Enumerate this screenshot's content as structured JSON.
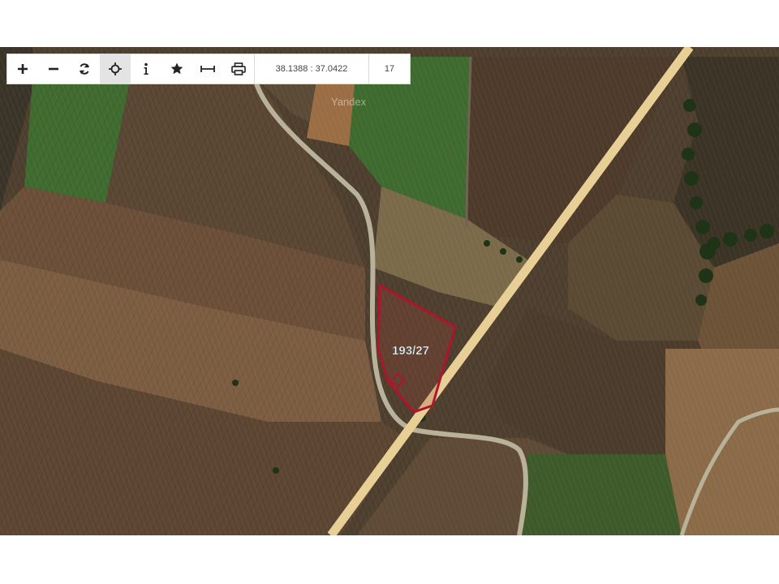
{
  "toolbar": {
    "tools": [
      {
        "icon": "zoom-in-icon",
        "label": "+"
      },
      {
        "icon": "zoom-out-icon",
        "label": "−"
      },
      {
        "icon": "refresh-icon",
        "label": "refresh"
      },
      {
        "icon": "locate-icon",
        "label": "locate",
        "active": true
      },
      {
        "icon": "info-icon",
        "label": "i"
      },
      {
        "icon": "star-icon",
        "label": "★"
      },
      {
        "icon": "measure-icon",
        "label": "measure"
      },
      {
        "icon": "print-icon",
        "label": "print"
      }
    ],
    "coordinates": "38.1388 : 37.0422",
    "zoom_level": "17"
  },
  "map": {
    "watermark": "Yandex",
    "parcel_label": "193/27",
    "colors": {
      "parcel_outline": "#b0142a",
      "road": "#e8cf96",
      "dirt_track": "#b9b29a",
      "field_green": "#3f6b2f",
      "field_brown": "#5a4633",
      "field_tan": "#8a6b4c"
    }
  }
}
